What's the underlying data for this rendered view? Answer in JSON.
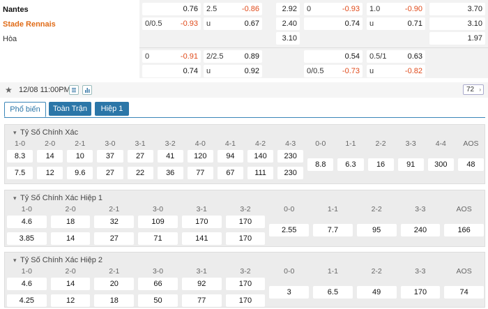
{
  "teams": {
    "home": "Nantes",
    "away": "Stade Rennais",
    "draw": "Hòa"
  },
  "odds_rows": [
    [
      {
        "left": "",
        "right": "0.76",
        "neg": false
      },
      {
        "left": "2.5",
        "right": "-0.86",
        "neg": true
      },
      {
        "single": "2.92"
      },
      {
        "left": "0",
        "right": "-0.93",
        "neg": true
      },
      {
        "left": "1.0",
        "right": "-0.90",
        "neg": true
      },
      {
        "single": "3.70"
      }
    ],
    [
      {
        "left": "0/0.5",
        "right": "-0.93",
        "neg": true
      },
      {
        "left": "u",
        "right": "0.67",
        "neg": false
      },
      {
        "single": "2.40"
      },
      {
        "left": "",
        "right": "0.74",
        "neg": false
      },
      {
        "left": "u",
        "right": "0.71",
        "neg": false
      },
      {
        "single": "3.10"
      }
    ],
    [
      null,
      null,
      {
        "single": "3.10"
      },
      null,
      null,
      {
        "single": "1.97"
      }
    ],
    [
      {
        "left": "0",
        "right": "-0.91",
        "neg": true
      },
      {
        "left": "2/2.5",
        "right": "0.89",
        "neg": false
      },
      null,
      {
        "left": "",
        "right": "0.54",
        "neg": false
      },
      {
        "left": "0.5/1",
        "right": "0.63",
        "neg": false
      },
      null
    ],
    [
      {
        "left": "",
        "right": "0.74",
        "neg": false
      },
      {
        "left": "u",
        "right": "0.92",
        "neg": false
      },
      null,
      {
        "left": "0/0.5",
        "right": "-0.73",
        "neg": true
      },
      {
        "left": "u",
        "right": "-0.82",
        "neg": true
      },
      null
    ]
  ],
  "meta": {
    "datetime": "12/08 11:00PM",
    "count": "72",
    "star_icon": "star-icon",
    "list_icon": "list-icon",
    "chart_icon": "chart-icon",
    "chevron": "chevron-down-icon"
  },
  "tabs": [
    {
      "label": "Phổ biến",
      "active": true
    },
    {
      "label": "Toàn Trận",
      "active": false
    },
    {
      "label": "Hiệp 1",
      "active": false
    }
  ],
  "sections": [
    {
      "title": "Tỷ Số Chính Xác",
      "headers": [
        "1-0",
        "2-0",
        "2-1",
        "3-0",
        "3-1",
        "3-2",
        "4-0",
        "4-1",
        "4-2",
        "4-3",
        "0-0",
        "1-1",
        "2-2",
        "3-3",
        "4-4",
        "AOS"
      ],
      "home": [
        "8.3",
        "14",
        "10",
        "37",
        "27",
        "41",
        "120",
        "94",
        "140",
        "230"
      ],
      "away": [
        "7.5",
        "12",
        "9.6",
        "27",
        "22",
        "36",
        "77",
        "67",
        "111",
        "230"
      ],
      "mid": [
        "8.8",
        "6.3",
        "16",
        "91",
        "300",
        "48"
      ]
    },
    {
      "title": "Tỷ Số Chính Xác Hiệp 1",
      "headers": [
        "1-0",
        "2-0",
        "2-1",
        "3-0",
        "3-1",
        "3-2",
        "0-0",
        "1-1",
        "2-2",
        "3-3",
        "AOS"
      ],
      "home": [
        "4.6",
        "18",
        "32",
        "109",
        "170",
        "170"
      ],
      "away": [
        "3.85",
        "14",
        "27",
        "71",
        "141",
        "170"
      ],
      "mid": [
        "2.55",
        "7.7",
        "95",
        "240",
        "166"
      ]
    },
    {
      "title": "Tỷ Số Chính Xác Hiệp 2",
      "headers": [
        "1-0",
        "2-0",
        "2-1",
        "3-0",
        "3-1",
        "3-2",
        "0-0",
        "1-1",
        "2-2",
        "3-3",
        "AOS"
      ],
      "home": [
        "4.6",
        "14",
        "20",
        "66",
        "92",
        "170"
      ],
      "away": [
        "4.25",
        "12",
        "18",
        "50",
        "77",
        "170"
      ],
      "mid": [
        "3",
        "6.5",
        "49",
        "170",
        "74"
      ]
    }
  ]
}
